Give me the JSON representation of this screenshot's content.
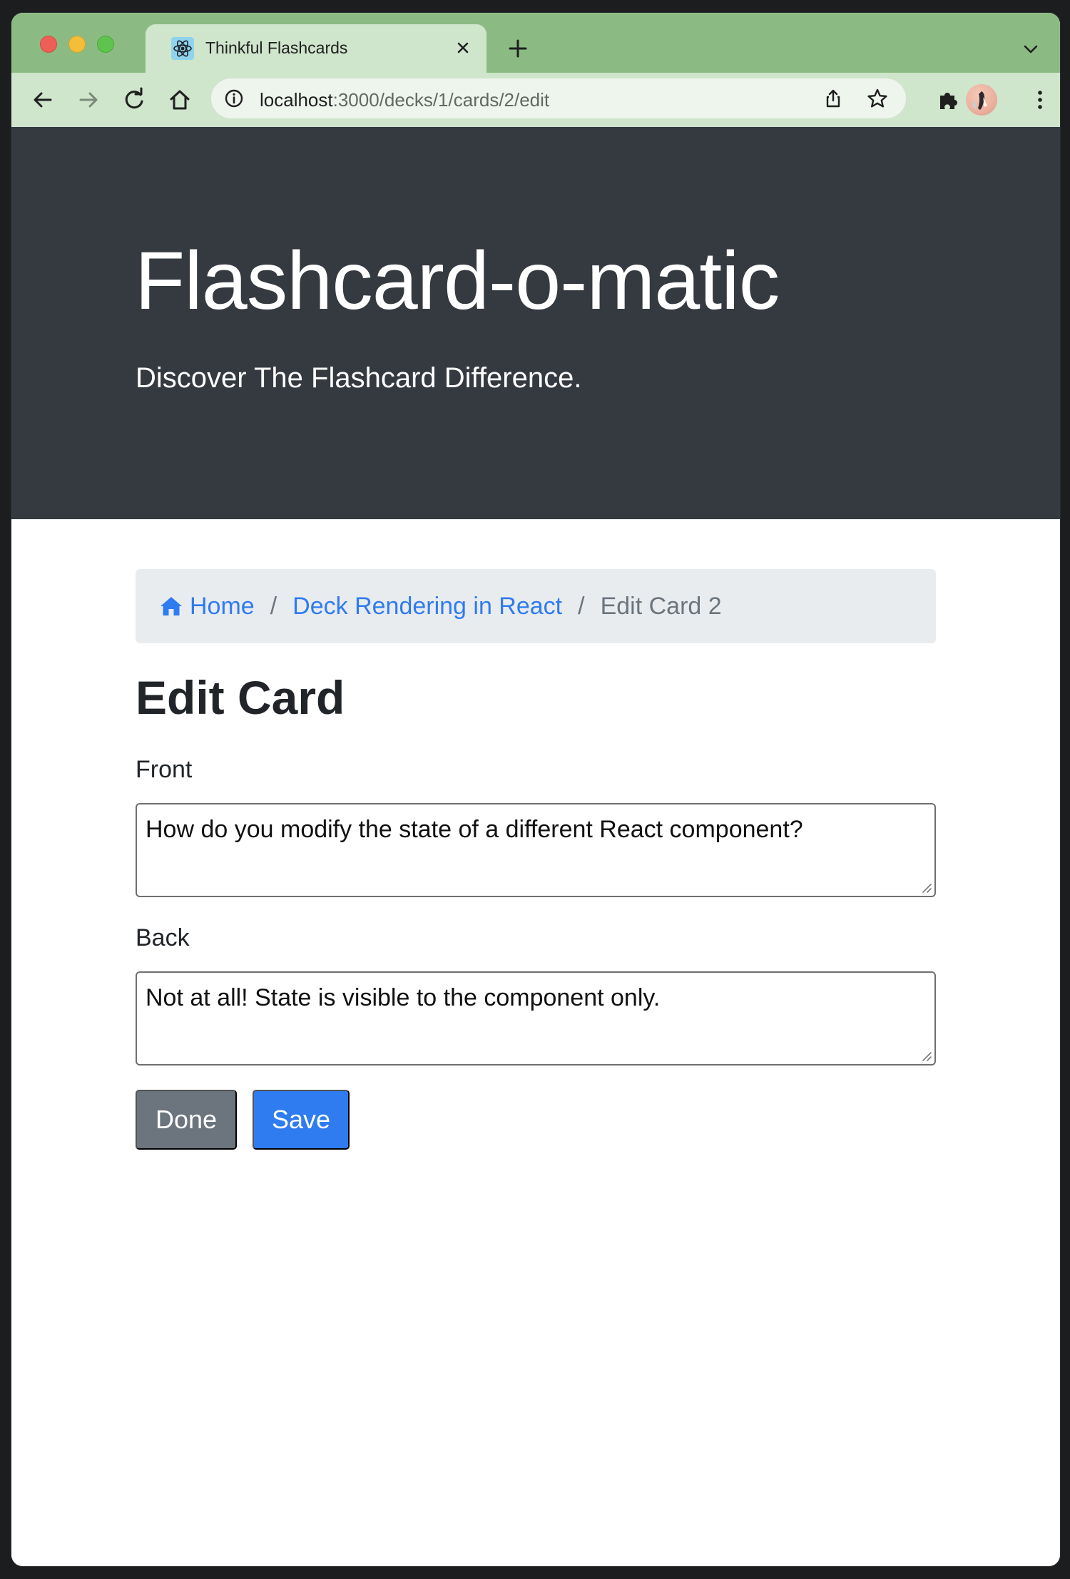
{
  "browser": {
    "tab_title": "Thinkful Flashcards",
    "url_host": "localhost",
    "url_path": ":3000/decks/1/cards/2/edit",
    "icons": [
      "react-favicon-icon",
      "close-icon",
      "plus-icon",
      "chevron-down-icon",
      "back-arrow-icon",
      "forward-arrow-icon",
      "reload-icon",
      "home-icon",
      "info-icon",
      "share-icon",
      "star-icon",
      "puzzle-icon",
      "avatar",
      "kebab-menu-icon"
    ]
  },
  "header": {
    "title": "Flashcard-o-matic",
    "lead": "Discover The Flashcard Difference."
  },
  "breadcrumb": {
    "home": "Home",
    "deck": "Deck Rendering in React",
    "separator": "/",
    "current": "Edit Card 2"
  },
  "form": {
    "heading": "Edit Card",
    "front_label": "Front",
    "front_value": "How do you modify the state of a different React component?",
    "back_label": "Back",
    "back_value": "Not at all! State is visible to the component only.",
    "done_label": "Done",
    "save_label": "Save"
  },
  "colors": {
    "tabstrip": "#8bbb83",
    "toolbar": "#cfe5cc",
    "jumbotron": "#343a40",
    "link": "#2f7bf0",
    "secondary_button": "#6c757d",
    "primary_button": "#2f7bf0"
  }
}
